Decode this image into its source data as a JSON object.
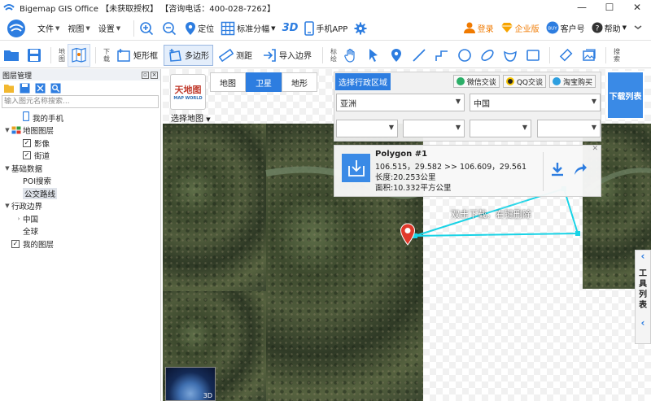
{
  "window": {
    "title": "Bigemap GIS Office 【未获取授权】 【咨询电话：400-028-7262】",
    "minimize": "—",
    "maximize": "☐",
    "close": "✕"
  },
  "menubar": {
    "items": [
      "文件",
      "视图",
      "设置"
    ],
    "locate": "定位",
    "grid": "标准分幅",
    "three_d": "3D",
    "mobile": "手机APP",
    "login": "登录",
    "enterprise": "企业版",
    "customer": "客户号",
    "help": "帮助"
  },
  "toolbar": {
    "map_label": "地图",
    "download_label": "下载",
    "rectangle": "矩形框",
    "polygon": "多边形",
    "measure": "测距",
    "import_border": "导入边界",
    "mark_label": "标绘",
    "search_label": "搜索"
  },
  "layer_panel": {
    "title": "图层管理",
    "search_placeholder": "输入图元名称搜索...",
    "tree": [
      {
        "label": "我的手机",
        "level": 1,
        "type": "phone"
      },
      {
        "label": "地图图层",
        "level": 0,
        "type": "folder"
      },
      {
        "label": "影像",
        "level": 1,
        "type": "check",
        "checked": true
      },
      {
        "label": "街道",
        "level": 1,
        "type": "check",
        "checked": true
      },
      {
        "label": "基础数据",
        "level": 0,
        "type": "expand"
      },
      {
        "label": "POI搜索",
        "level": 1,
        "type": "plain"
      },
      {
        "label": "公交路线",
        "level": 1,
        "type": "plain",
        "selected": true
      },
      {
        "label": "行政边界",
        "level": 0,
        "type": "expand"
      },
      {
        "label": "中国",
        "level": 1,
        "type": "collapsed"
      },
      {
        "label": "全球",
        "level": 1,
        "type": "plain"
      },
      {
        "label": "我的图层",
        "level": 0,
        "type": "check",
        "checked": true
      }
    ]
  },
  "map": {
    "logo_top": "天地图",
    "logo_bottom": "MAP WORLD",
    "select_map": "选择地图",
    "types": [
      "地图",
      "卫星",
      "地形"
    ],
    "active_type": "卫星",
    "region": {
      "title": "选择行政区域",
      "wechat": "微信交谈",
      "qq": "QQ交谈",
      "taobao": "淘宝购买",
      "continent": "亚洲",
      "country": "中国"
    },
    "download_list": "下载列表",
    "polygon": {
      "name": "Polygon #1",
      "coords": "106.515，29.582 >> 106.609，29.561",
      "length": "长度:20.253公里",
      "area": "面积:10.332平方公里"
    },
    "hint": "双击下载，右键删除",
    "watermark": "预复网",
    "watermark_url": "www.yxfw.com",
    "side_tools": "工具列表",
    "minimap_label": "3D"
  },
  "colors": {
    "accent": "#2d7de0",
    "cyan_line": "#19d3e6",
    "marker": "#e0392b"
  }
}
